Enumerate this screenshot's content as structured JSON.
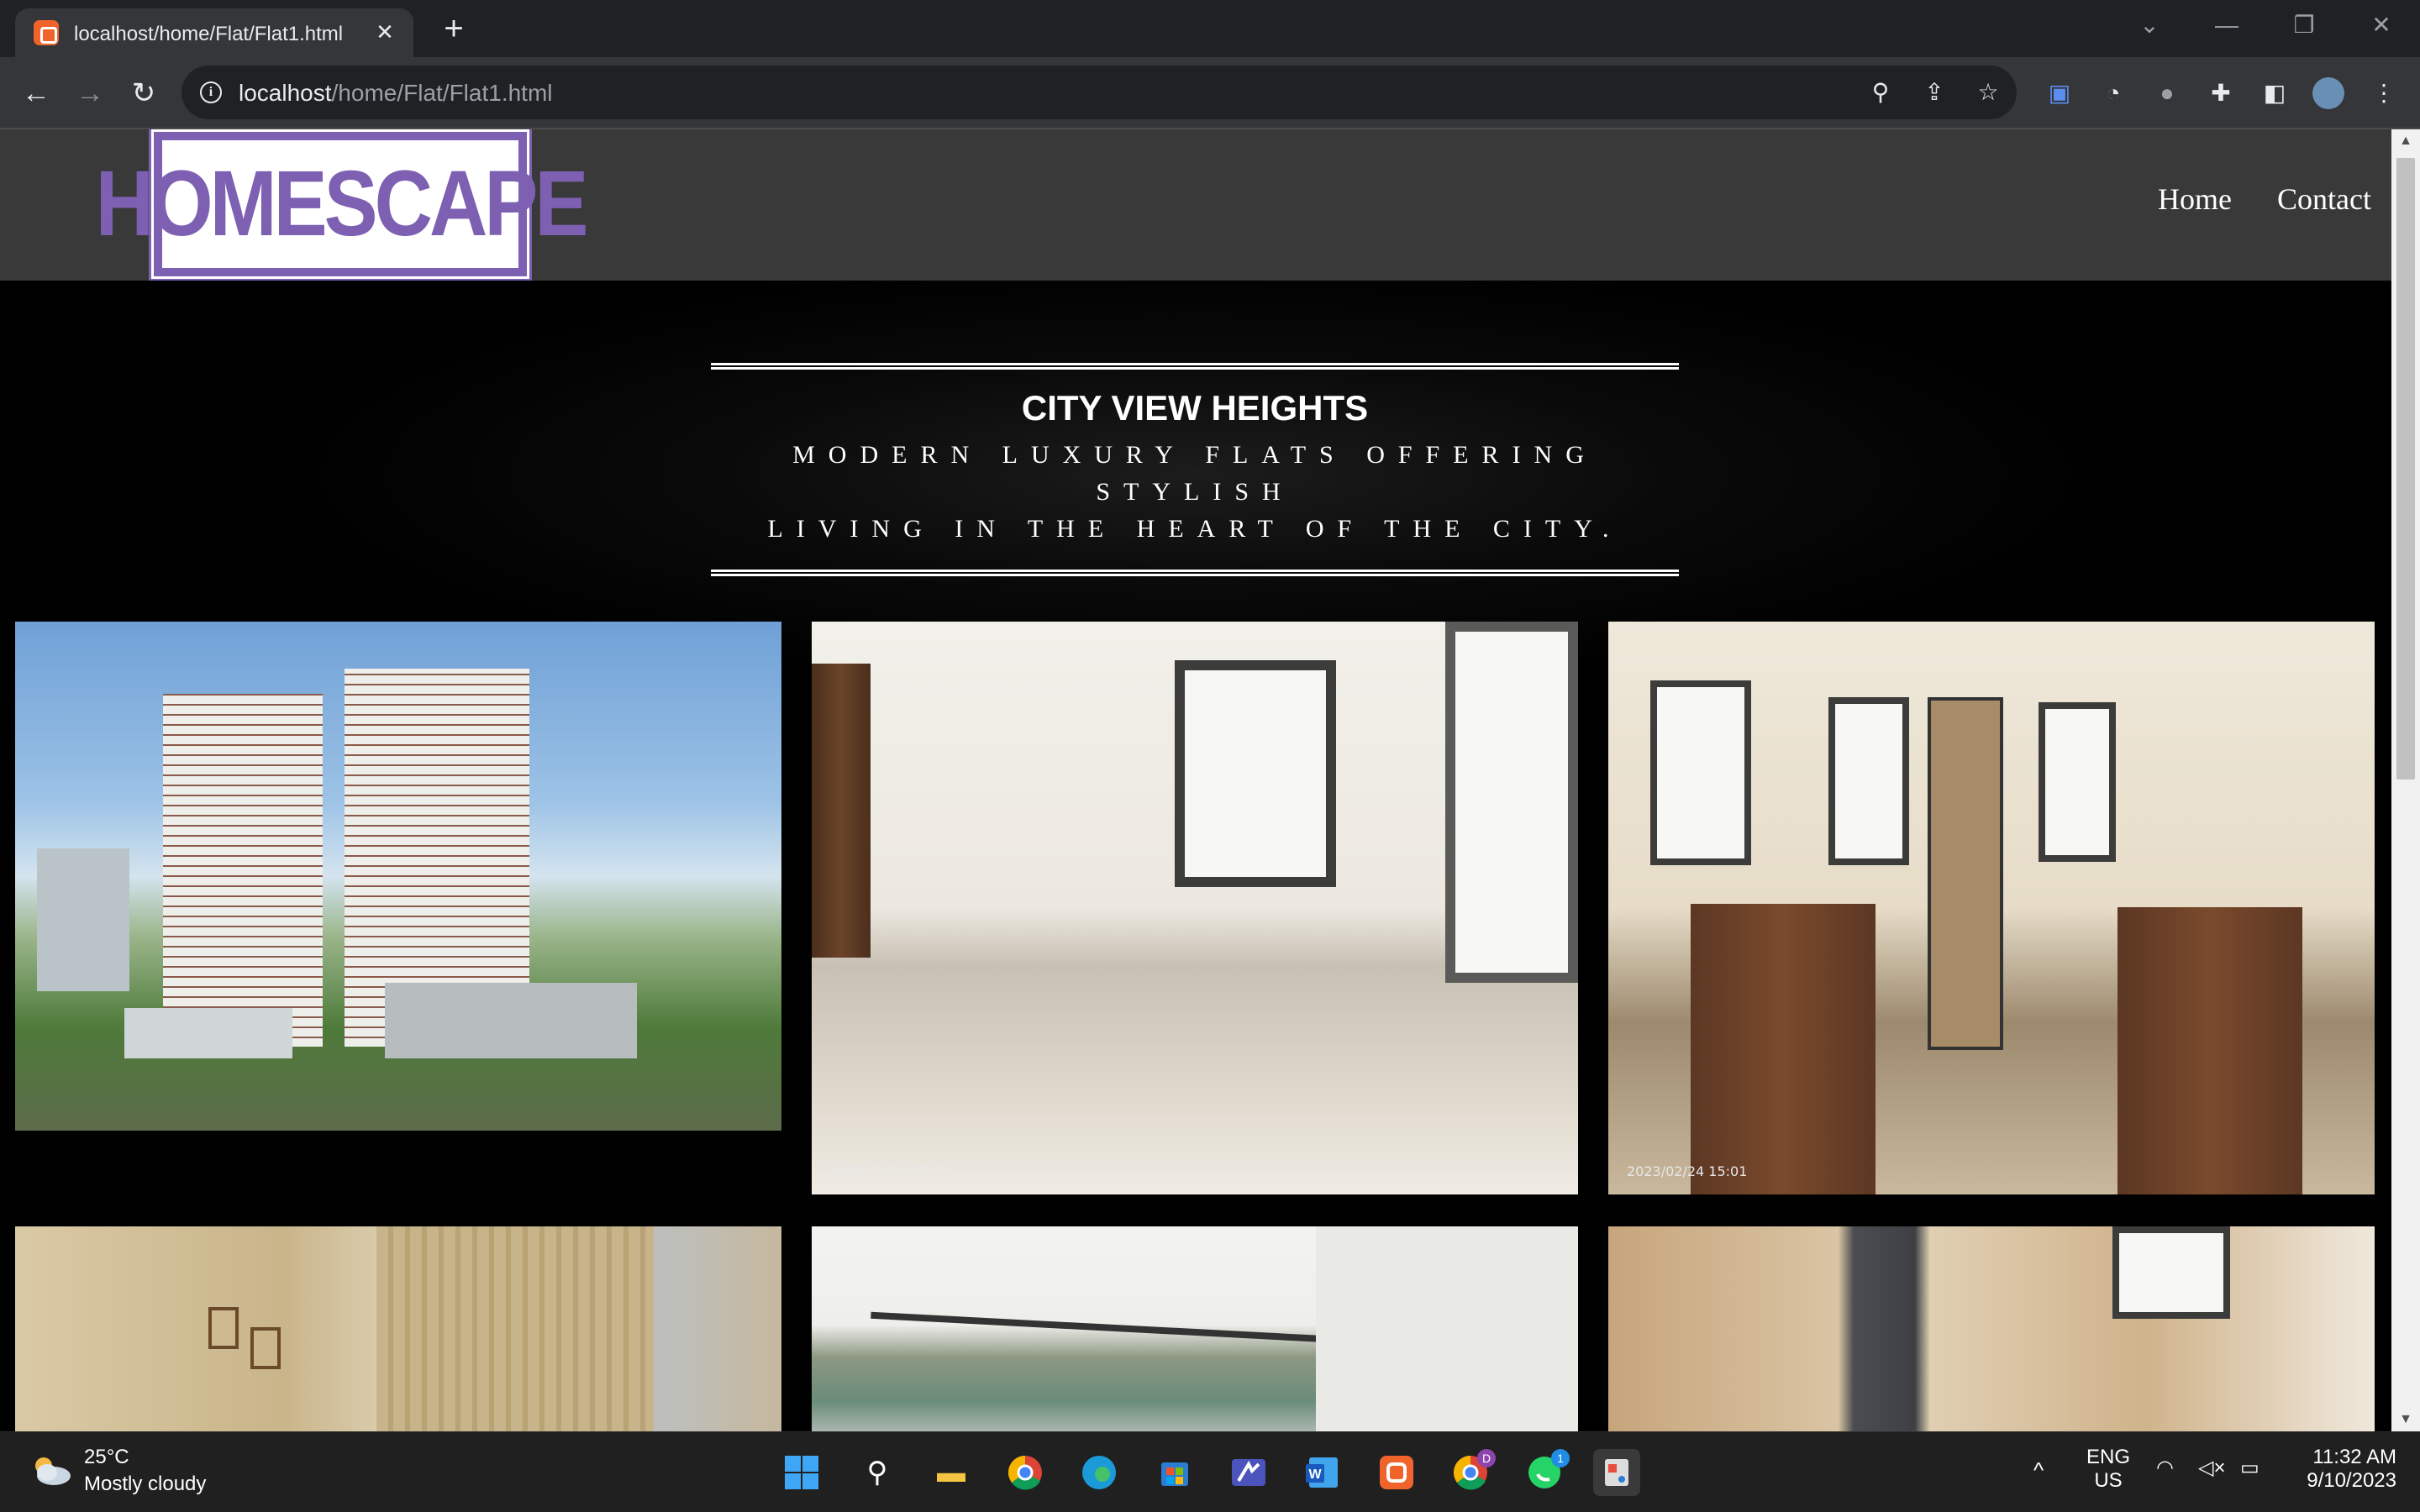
{
  "browser": {
    "tab_title": "localhost/home/Flat/Flat1.html",
    "url_host": "localhost",
    "url_path": "/home/Flat/Flat1.html"
  },
  "site": {
    "logo_text": "HOMESCAPE",
    "nav": [
      "Home",
      "Contact"
    ],
    "hero_title": "CITY VIEW HEIGHTS",
    "hero_subtitle_line1": "MODERN LUXURY FLATS OFFERING STYLISH",
    "hero_subtitle_line2": "LIVING IN THE HEART OF THE CITY.",
    "photo_timestamp": "2023/02/24 15:01"
  },
  "taskbar": {
    "temperature": "25°C",
    "weather": "Mostly cloudy",
    "lang_line1": "ENG",
    "lang_line2": "US",
    "time": "11:32 AM",
    "date": "9/10/2023",
    "whatsapp_badge": "1",
    "chrome_profile_badge": "D"
  },
  "colors": {
    "logo_purple": "#7d60b2",
    "header_gray": "#393939",
    "chrome_dark": "#202124"
  }
}
